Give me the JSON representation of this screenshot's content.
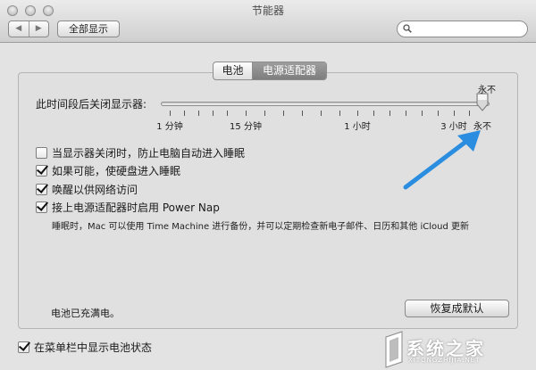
{
  "window": {
    "title": "节能器"
  },
  "toolbar": {
    "back_glyph": "◀",
    "forward_glyph": "▶",
    "show_all_label": "全部显示",
    "search_placeholder": ""
  },
  "tabs": [
    {
      "label": "电池",
      "selected": false
    },
    {
      "label": "电源适配器",
      "selected": true
    }
  ],
  "display_sleep": {
    "label": "此时间段后关闭显示器:",
    "value_label": "永不",
    "slider_position": 1.0,
    "ticks": [
      {
        "label": "1 分钟"
      },
      {
        "label": "15 分钟"
      },
      {
        "label": "1 小时"
      },
      {
        "label": "3 小时"
      },
      {
        "label": "永不"
      }
    ]
  },
  "options": [
    {
      "label": "当显示器关闭时，防止电脑自动进入睡眠",
      "checked": false
    },
    {
      "label": "如果可能，使硬盘进入睡眠",
      "checked": true
    },
    {
      "label": "唤醒以供网络访问",
      "checked": true
    },
    {
      "label": "接上电源适配器时启用 Power Nap",
      "checked": true
    }
  ],
  "power_nap_description": "睡眠时，Mac 可以使用 Time Machine 进行备份，并可以定期检查新电子邮件、日历和其他 iCloud 更新",
  "battery_status": "电池已充满电。",
  "restore_defaults_label": "恢复成默认",
  "menu_bar_option": {
    "label": "在菜单栏中显示电池状态",
    "checked": true
  },
  "watermark": {
    "text": "系统之家",
    "subtext": "XITONGZHIJIA.NET"
  },
  "colors": {
    "arrow": "#2a8de0",
    "selected_tab": "#8a8a8a"
  }
}
